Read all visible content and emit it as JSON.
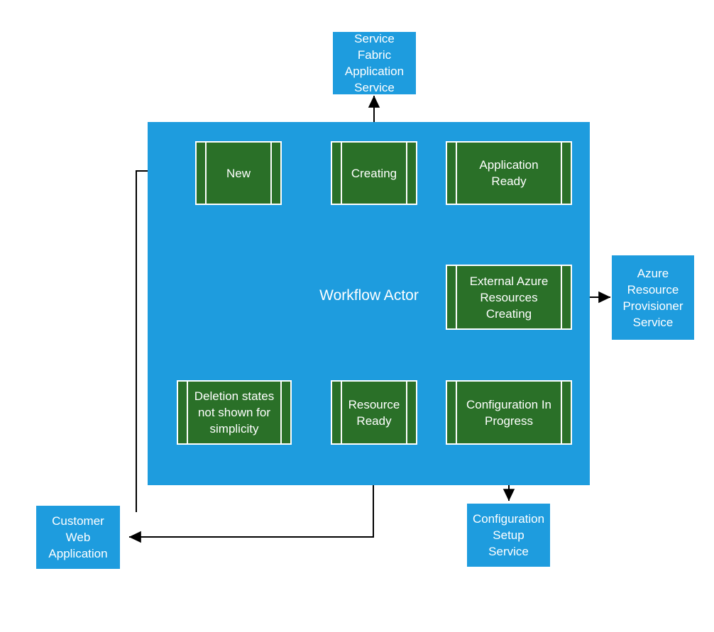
{
  "diagram": {
    "title": "Workflow Actor state machine",
    "colors": {
      "container_blue": "#1E9CDE",
      "service_blue": "#1E9CDE",
      "state_green": "#2A7028",
      "box_border": "#FFFFFF",
      "connector": "#000000",
      "text": "#FFFFFF",
      "background": "#FFFFFF"
    },
    "container": {
      "label": "Workflow Actor"
    },
    "states": [
      {
        "id": "new",
        "label": "New"
      },
      {
        "id": "creating",
        "label": "Creating"
      },
      {
        "id": "application-ready",
        "label": "Application\nReady"
      },
      {
        "id": "application-ready-line1",
        "label": "Application"
      },
      {
        "id": "application-ready-line2",
        "label": "Ready"
      },
      {
        "id": "external-azure-resources-creating-line1",
        "label": "External Azure"
      },
      {
        "id": "external-azure-resources-creating-line2",
        "label": "Resources"
      },
      {
        "id": "external-azure-resources-creating-line3",
        "label": "Creating"
      },
      {
        "id": "configuration-in-progress-line1",
        "label": "Configuration In"
      },
      {
        "id": "configuration-in-progress-line2",
        "label": "Progress"
      },
      {
        "id": "resource-ready-line1",
        "label": "Resource"
      },
      {
        "id": "resource-ready-line2",
        "label": "Ready"
      },
      {
        "id": "note-line1",
        "label": "Deletion states"
      },
      {
        "id": "note-line2",
        "label": "not shown for"
      },
      {
        "id": "note-line3",
        "label": "simplicity"
      }
    ],
    "services": [
      {
        "id": "service-fabric-application-service",
        "lines": [
          "Service Fabric",
          "Application",
          "Service"
        ]
      },
      {
        "id": "azure-resource-provisioner-service",
        "lines": [
          "Azure",
          "Resource",
          "Provisioner",
          "Service"
        ]
      },
      {
        "id": "configuration-setup-service",
        "lines": [
          "Configuration",
          "Setup Service"
        ]
      },
      {
        "id": "customer-web-application",
        "lines": [
          "Customer",
          "Web",
          "Application"
        ]
      }
    ],
    "service_fabric": {
      "l1": "Service Fabric",
      "l2": "Application",
      "l3": "Service"
    },
    "azure_provisioner": {
      "l1": "Azure",
      "l2": "Resource",
      "l3": "Provisioner",
      "l4": "Service"
    },
    "config_setup": {
      "l1": "Configuration",
      "l2": "Setup Service"
    },
    "customer_web": {
      "l1": "Customer",
      "l2": "Web",
      "l3": "Application"
    },
    "connections": [
      {
        "from": "customer-web-application",
        "to": "new",
        "type": "arrow"
      },
      {
        "from": "new",
        "to": "creating",
        "type": "arrow"
      },
      {
        "from": "creating",
        "to": "application-ready",
        "type": "arrow"
      },
      {
        "from": "creating",
        "to": "service-fabric-application-service",
        "type": "double-arrow"
      },
      {
        "from": "application-ready",
        "to": "external-azure-resources-creating",
        "type": "arrow"
      },
      {
        "from": "external-azure-resources-creating",
        "to": "azure-resource-provisioner-service",
        "type": "double-arrow"
      },
      {
        "from": "external-azure-resources-creating",
        "to": "configuration-in-progress",
        "type": "arrow"
      },
      {
        "from": "configuration-in-progress",
        "to": "configuration-setup-service",
        "type": "double-arrow"
      },
      {
        "from": "configuration-in-progress",
        "to": "resource-ready",
        "type": "arrow"
      },
      {
        "from": "resource-ready",
        "to": "customer-web-application",
        "type": "arrow"
      }
    ]
  }
}
